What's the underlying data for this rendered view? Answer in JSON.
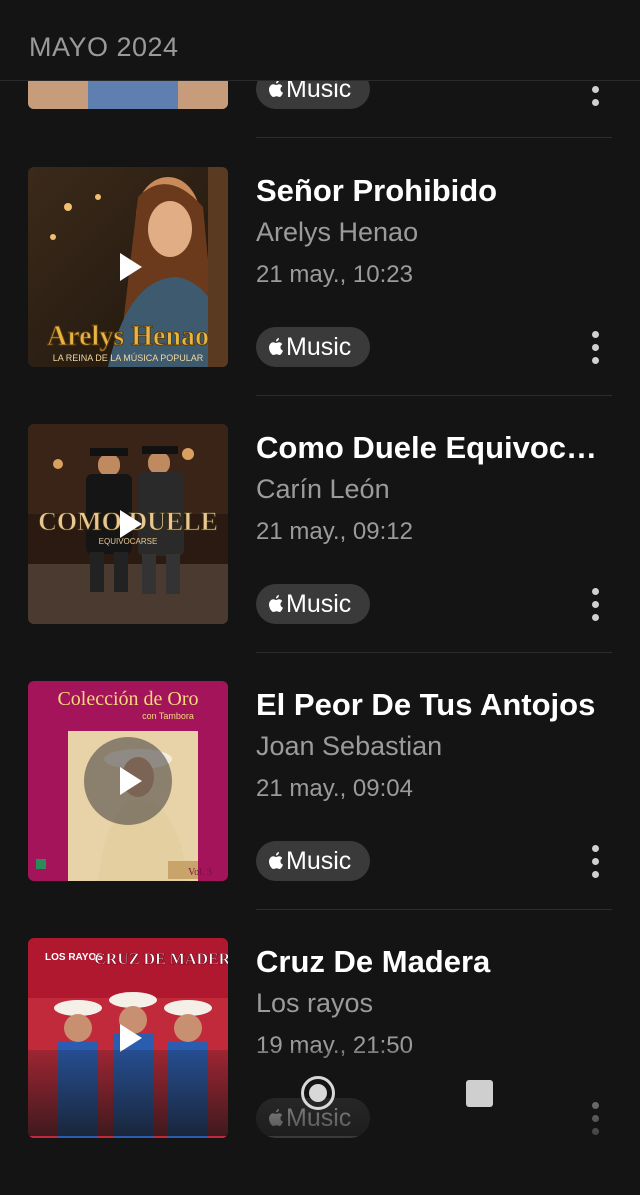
{
  "header": {
    "title": "MAYO 2024"
  },
  "badge_label": "Music",
  "items": [
    {
      "song": "",
      "artist": "",
      "date": ""
    },
    {
      "song": "Señor Prohibido",
      "artist": "Arelys Henao",
      "date": "21 may., 10:23",
      "art_text": "Arelys Henao",
      "art_subtext": "LA REINA DE LA MÚSICA POPULAR"
    },
    {
      "song": "Como Duele Equivocarse",
      "artist": "Carín León",
      "date": "21 may., 09:12",
      "art_text": "COMO DUELE",
      "art_subtext": "EQUIVOCARSE"
    },
    {
      "song": "El Peor De Tus Antojos",
      "artist": "Joan Sebastian",
      "date": "21 may., 09:04",
      "art_text": "Colección de Oro",
      "art_subtext": "con Tambora",
      "art_vol": "Vol. 3"
    },
    {
      "song": "Cruz De Madera",
      "artist": "Los rayos",
      "date": "19 may., 21:50",
      "art_text": "CRUZ DE MADERA",
      "art_subtext": "LOS RAYOS"
    }
  ],
  "colors": {
    "background": "#141414",
    "badge": "#3a3a3a",
    "secondary_text": "#9b9b9b"
  },
  "icons": [
    "apple-icon",
    "play-icon",
    "more-vertical-icon",
    "home-icon",
    "recents-icon"
  ]
}
